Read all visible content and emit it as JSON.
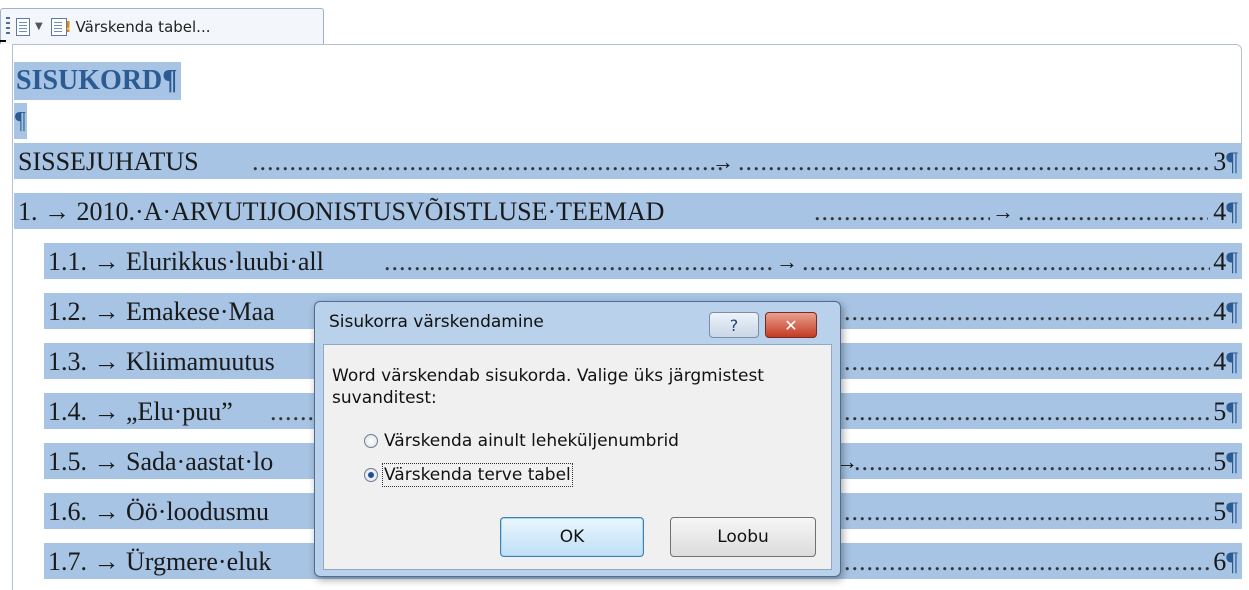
{
  "content_control": {
    "update_label": "Värskenda tabel...",
    "icons": [
      "grip-icon",
      "document-options-icon",
      "dropdown-arrow-icon",
      "update-table-icon"
    ]
  },
  "document": {
    "heading": "SISUKORD",
    "pilcrow": "¶",
    "toc": [
      {
        "text": "SISSEJUHATUS",
        "page": "3"
      },
      {
        "text": "1. → 2010.·A·ARVUTIJOONISTUSVÕISTLUSE·TEEMAD",
        "page": "4"
      },
      {
        "text": "1.1. → Elurikkus·luubi·all",
        "page": "4"
      },
      {
        "text": "1.2. → Emakese·Maa",
        "page": "4"
      },
      {
        "text": "1.3. → Kliimamuutus",
        "page": "4"
      },
      {
        "text": "1.4. → „Elu·puu”",
        "page": "5"
      },
      {
        "text": "1.5. → Sada·aastat·lo",
        "page": "5"
      },
      {
        "text": "1.6. → Öö·loodusmu",
        "page": "5"
      },
      {
        "text": "1.7. → Ürgmere·eluk",
        "page": "6"
      }
    ]
  },
  "dialog": {
    "title": "Sisukorra värskendamine",
    "help": "?",
    "close": "✕",
    "message": "Word värskendab sisukorda. Valige üks järgmistest suvanditest:",
    "options": [
      {
        "label": "Värskenda ainult leheküljenumbrid",
        "selected": false
      },
      {
        "label": "Värskenda terve tabel",
        "selected": true
      }
    ],
    "ok_label": "OK",
    "cancel_label": "Loobu"
  }
}
